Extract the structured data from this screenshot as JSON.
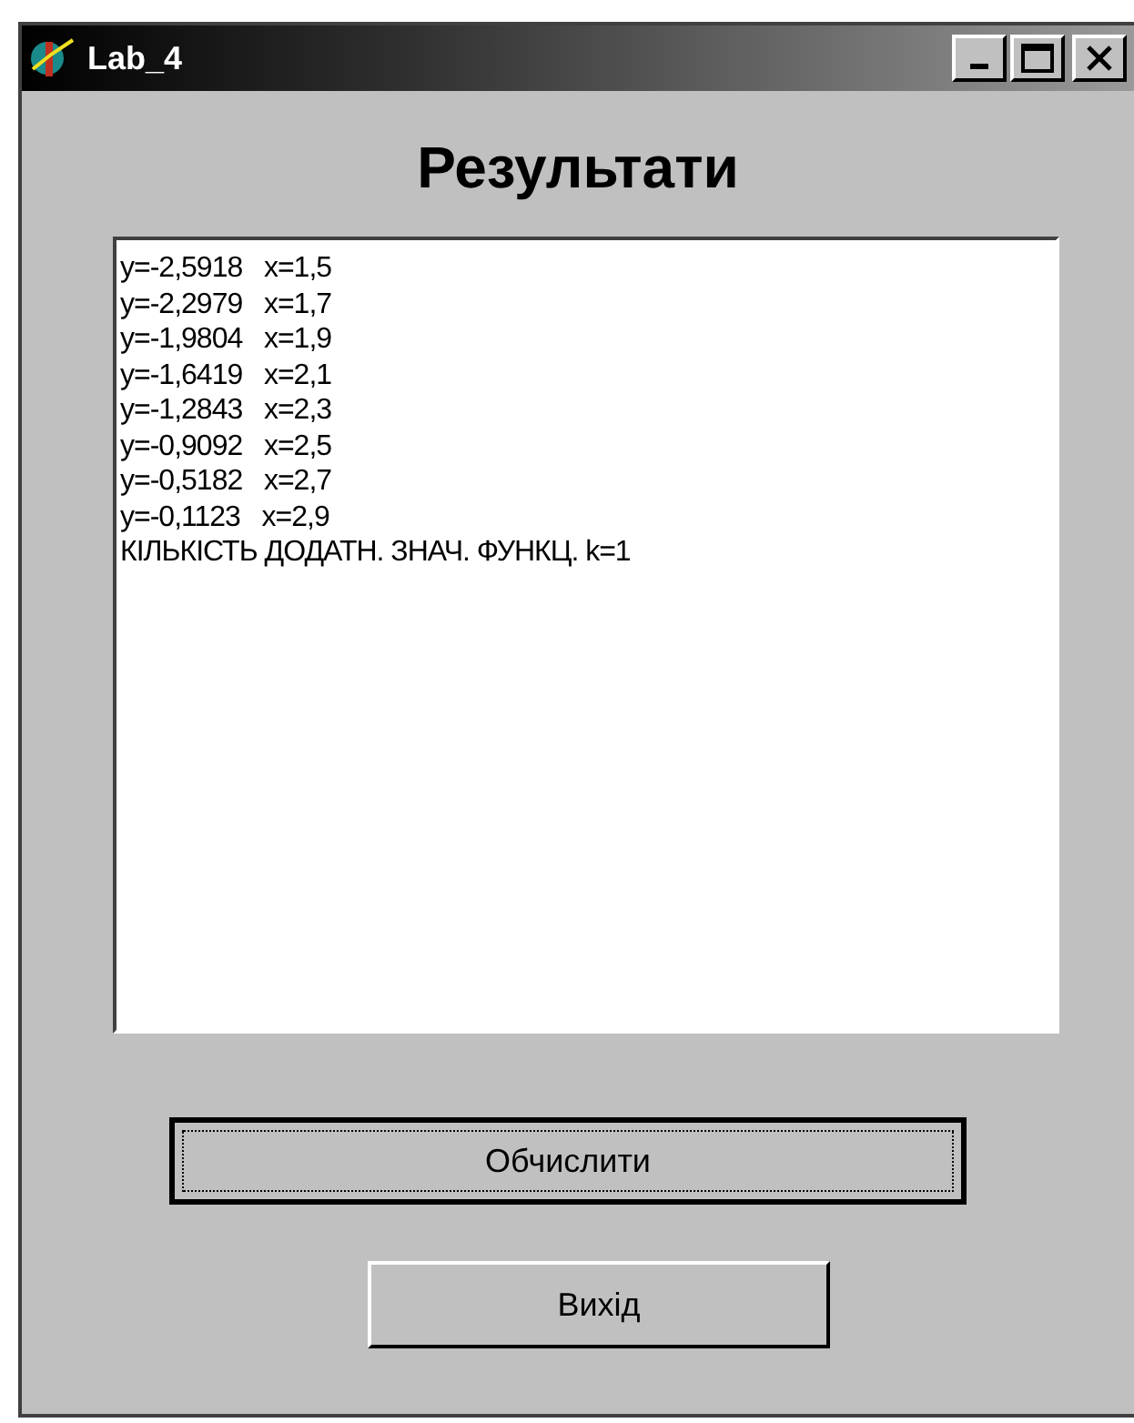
{
  "window": {
    "title": "Lab_4"
  },
  "heading": "Результати",
  "memo": {
    "lines": [
      "y=-2,5918   x=1,5",
      "y=-2,2979   x=1,7",
      "y=-1,9804   x=1,9",
      "y=-1,6419   x=2,1",
      "y=-1,2843   x=2,3",
      "y=-0,9092   x=2,5",
      "y=-0,5182   x=2,7",
      "y=-0,1123   x=2,9",
      "КІЛЬКІСТЬ ДОДАТН. ЗНАЧ. ФУНКЦ. k=1"
    ]
  },
  "buttons": [
    {
      "label": "Обчислити",
      "focused": true,
      "kind": "wide"
    },
    {
      "label": "Вихід",
      "focused": false,
      "kind": "narrow"
    }
  ]
}
